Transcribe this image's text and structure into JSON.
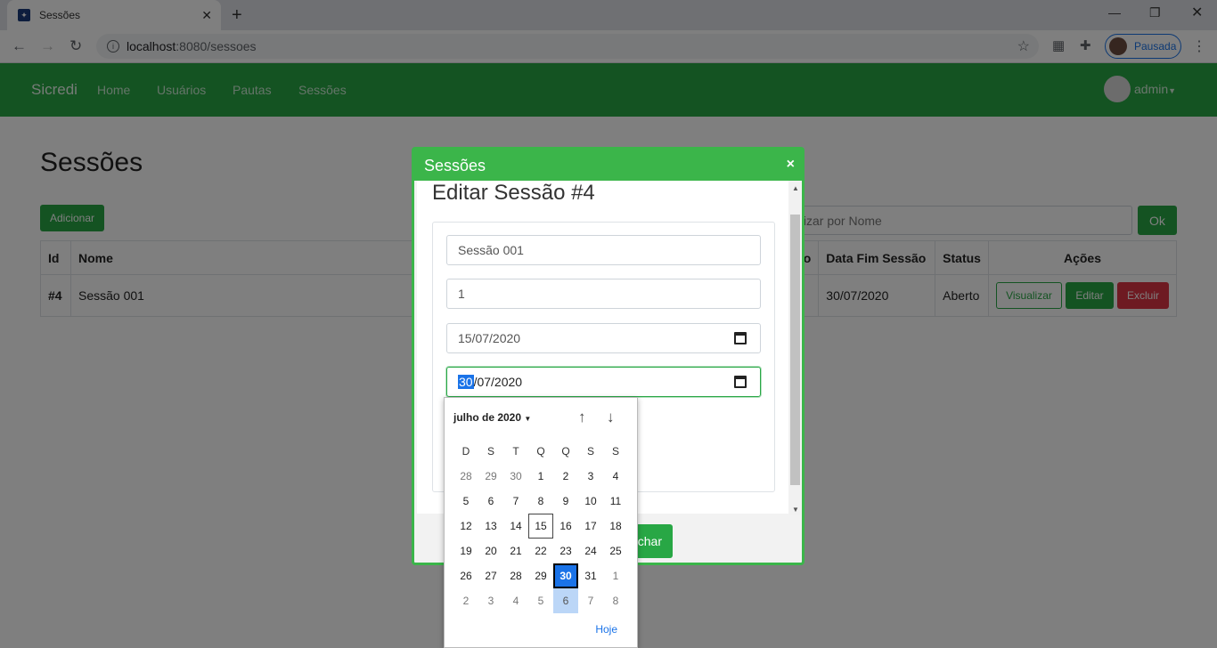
{
  "browser": {
    "tab_title": "Sessões",
    "url_host": "localhost",
    "url_path": ":8080/sessoes",
    "profile_label": "Pausada"
  },
  "nav": {
    "brand": "Sicredi",
    "links": [
      "Home",
      "Usuários",
      "Pautas",
      "Sessões"
    ],
    "user": "admin"
  },
  "page": {
    "title": "Sessões",
    "add_label": "Adicionar",
    "search_placeholder": "alizar por Nome",
    "ok_label": "Ok"
  },
  "table": {
    "headers": {
      "id": "Id",
      "name": "Nome",
      "partial": "o",
      "end": "Data Fim Sessão",
      "status": "Status",
      "actions": "Ações"
    },
    "rows": [
      {
        "id": "#4",
        "name": "Sessão 001",
        "end": "30/07/2020",
        "status": "Aberto",
        "view": "Visualizar",
        "edit": "Editar",
        "delete": "Excluir"
      }
    ]
  },
  "modal": {
    "header": "Sessões",
    "close": "×",
    "title": "Editar Sessão #4",
    "fields": {
      "name": "Sessão 001",
      "pauta": "1",
      "start_date": "15/07/2020",
      "end_day": "30",
      "end_rest": "/07/2020"
    },
    "footer_btn": "char"
  },
  "datepicker": {
    "month_label": "julho de 2020",
    "weekdays": [
      "D",
      "S",
      "T",
      "Q",
      "Q",
      "S",
      "S"
    ],
    "days": [
      [
        "28",
        "29",
        "30",
        "1",
        "2",
        "3",
        "4"
      ],
      [
        "5",
        "6",
        "7",
        "8",
        "9",
        "10",
        "11"
      ],
      [
        "12",
        "13",
        "14",
        "15",
        "16",
        "17",
        "18"
      ],
      [
        "19",
        "20",
        "21",
        "22",
        "23",
        "24",
        "25"
      ],
      [
        "26",
        "27",
        "28",
        "29",
        "30",
        "31",
        "1"
      ],
      [
        "2",
        "3",
        "4",
        "5",
        "6",
        "7",
        "8"
      ]
    ],
    "today_label": "Hoje"
  }
}
